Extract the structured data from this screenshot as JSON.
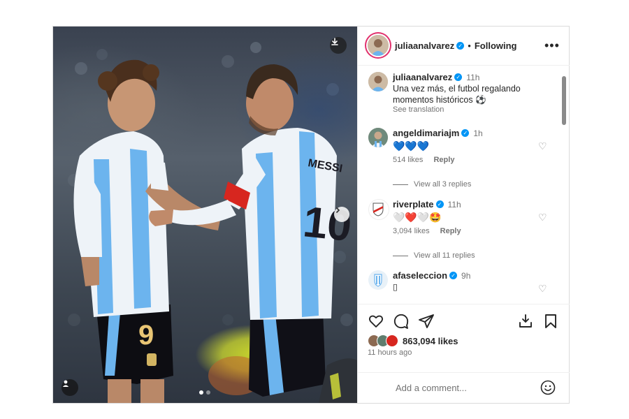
{
  "post": {
    "username": "juliaanalvarez",
    "separator": "•",
    "follow_status": "Following",
    "more": "•••"
  },
  "photo": {
    "jersey_number_left": "9",
    "jersey_number_right": "10",
    "jersey_name_right": "MESSI",
    "carousel_total": 2,
    "carousel_active": 1
  },
  "comments": [
    {
      "username": "juliaanalvarez",
      "time": "11h",
      "text": "Una vez más, el futbol regalando momentos históricos ⚽",
      "see_translation": "See translation"
    },
    {
      "username": "angeldimariajm",
      "time": "1h",
      "text": "💙💙💙",
      "likes": "514 likes",
      "reply": "Reply",
      "view_replies": "View all 3 replies"
    },
    {
      "username": "riverplate",
      "time": "11h",
      "text": "🤍❤️🤍🤩",
      "likes": "3,094 likes",
      "reply": "Reply",
      "view_replies": "View all 11 replies"
    },
    {
      "username": "afaseleccion",
      "time": "9h",
      "text": "▯"
    }
  ],
  "actions": {
    "likes": "863,094 likes",
    "time_ago": "11 hours ago"
  },
  "add_comment": {
    "placeholder": "Add a comment..."
  },
  "colors": {
    "verified": "#0095f6",
    "story_ring": "#e1306c",
    "argentina_blue": "#6cb4ee"
  }
}
